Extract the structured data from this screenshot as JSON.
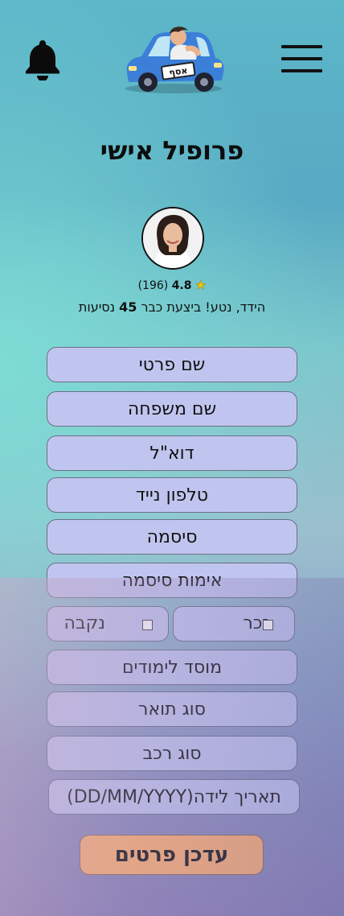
{
  "header": {
    "menu_icon": "hamburger-menu-icon",
    "bell_icon": "bell-icon",
    "logo_plate": "אסף"
  },
  "page": {
    "title": "פרופיל אישי"
  },
  "profile": {
    "rating": "4.8",
    "reviews": "(196)",
    "greeting_prefix": "הידד, נטע! ביצעת כבר ",
    "rides_count": "45",
    "greeting_suffix": " נסיעות"
  },
  "form": {
    "first_name": "שם פרטי",
    "last_name": "שם משפחה",
    "email": "דוא\"ל",
    "phone": "טלפון נייד",
    "password": "סיסמה",
    "password_confirm": "אימות סיסמה",
    "gender_male": "זכר",
    "gender_female": "נקבה",
    "institution": "מוסד לימודים",
    "degree": "סוג תואר",
    "vehicle": "סוג רכב",
    "birthdate": "תאריך לידה(DD/MM/YYYY)",
    "submit": "עדכן פרטים"
  },
  "colors": {
    "field_bg": "#c0c5ef",
    "submit_bg": "#ffb070",
    "star": "#f5c800"
  }
}
